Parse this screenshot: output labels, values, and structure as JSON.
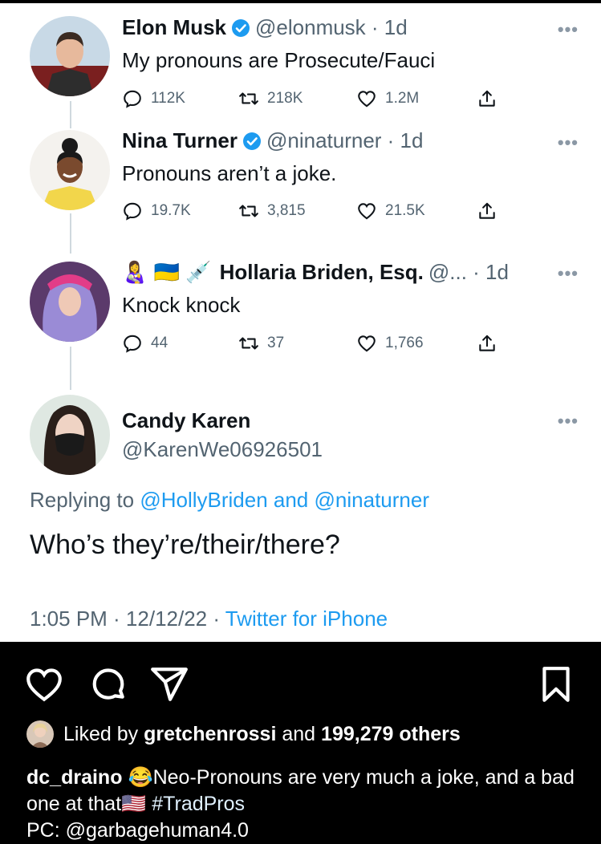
{
  "tweets": [
    {
      "name": "Elon Musk",
      "handle": "@elonmusk · 1d",
      "text": "My pronouns are Prosecute/Fauci",
      "replies": "112K",
      "retweets": "218K",
      "likes": "1.2M"
    },
    {
      "name": "Nina Turner",
      "handle": "@ninaturner · 1d",
      "text": "Pronouns aren’t a joke.",
      "replies": "19.7K",
      "retweets": "3,815",
      "likes": "21.5K"
    },
    {
      "name": "Hollaria Briden, Esq.",
      "handle": "@... · 1d",
      "emojis": "👩‍🍼 🇺🇦 💉",
      "text": "Knock knock",
      "replies": "44",
      "retweets": "37",
      "likes": "1,766"
    }
  ],
  "main_tweet": {
    "name": "Candy Karen",
    "handle": "@KarenWe06926501",
    "reply_prefix": "Replying to",
    "reply_user1": "@HollyBriden",
    "reply_and": "and",
    "reply_user2": "@ninaturner",
    "text": "Who’s they’re/their/there?",
    "time": "1:05 PM · 12/12/22 ·",
    "source": "Twitter for iPhone"
  },
  "more_label": "•••",
  "instagram": {
    "liked_by_prefix": "Liked by",
    "liked_by_user": "gretchenrossi",
    "liked_by_and": "and",
    "liked_by_count": "199,279 others",
    "caption_user": "dc_draino",
    "caption_emoji1": "😂",
    "caption_text1": "Neo-Pronouns are very much a joke, and a bad one at that",
    "caption_emoji2": "🇺🇸",
    "caption_tag": "#TradPros",
    "caption_pc": "PC: @garbagehuman4.0"
  },
  "colors": {
    "verified": "#1d9bf0",
    "link": "#1d9bf0",
    "secondary_text": "#536471"
  }
}
